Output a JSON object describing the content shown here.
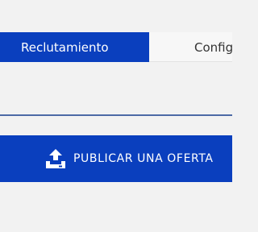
{
  "tabs": [
    {
      "label": "Reclutamiento",
      "active": true
    },
    {
      "label": "Config",
      "active": false
    }
  ],
  "actions": {
    "publish_label": "PUBLICAR UNA OFERTA",
    "publish_icon": "upload-icon"
  },
  "colors": {
    "primary": "#0a3fbe",
    "background": "#f2f2f2",
    "divider": "#4d6aa6"
  }
}
